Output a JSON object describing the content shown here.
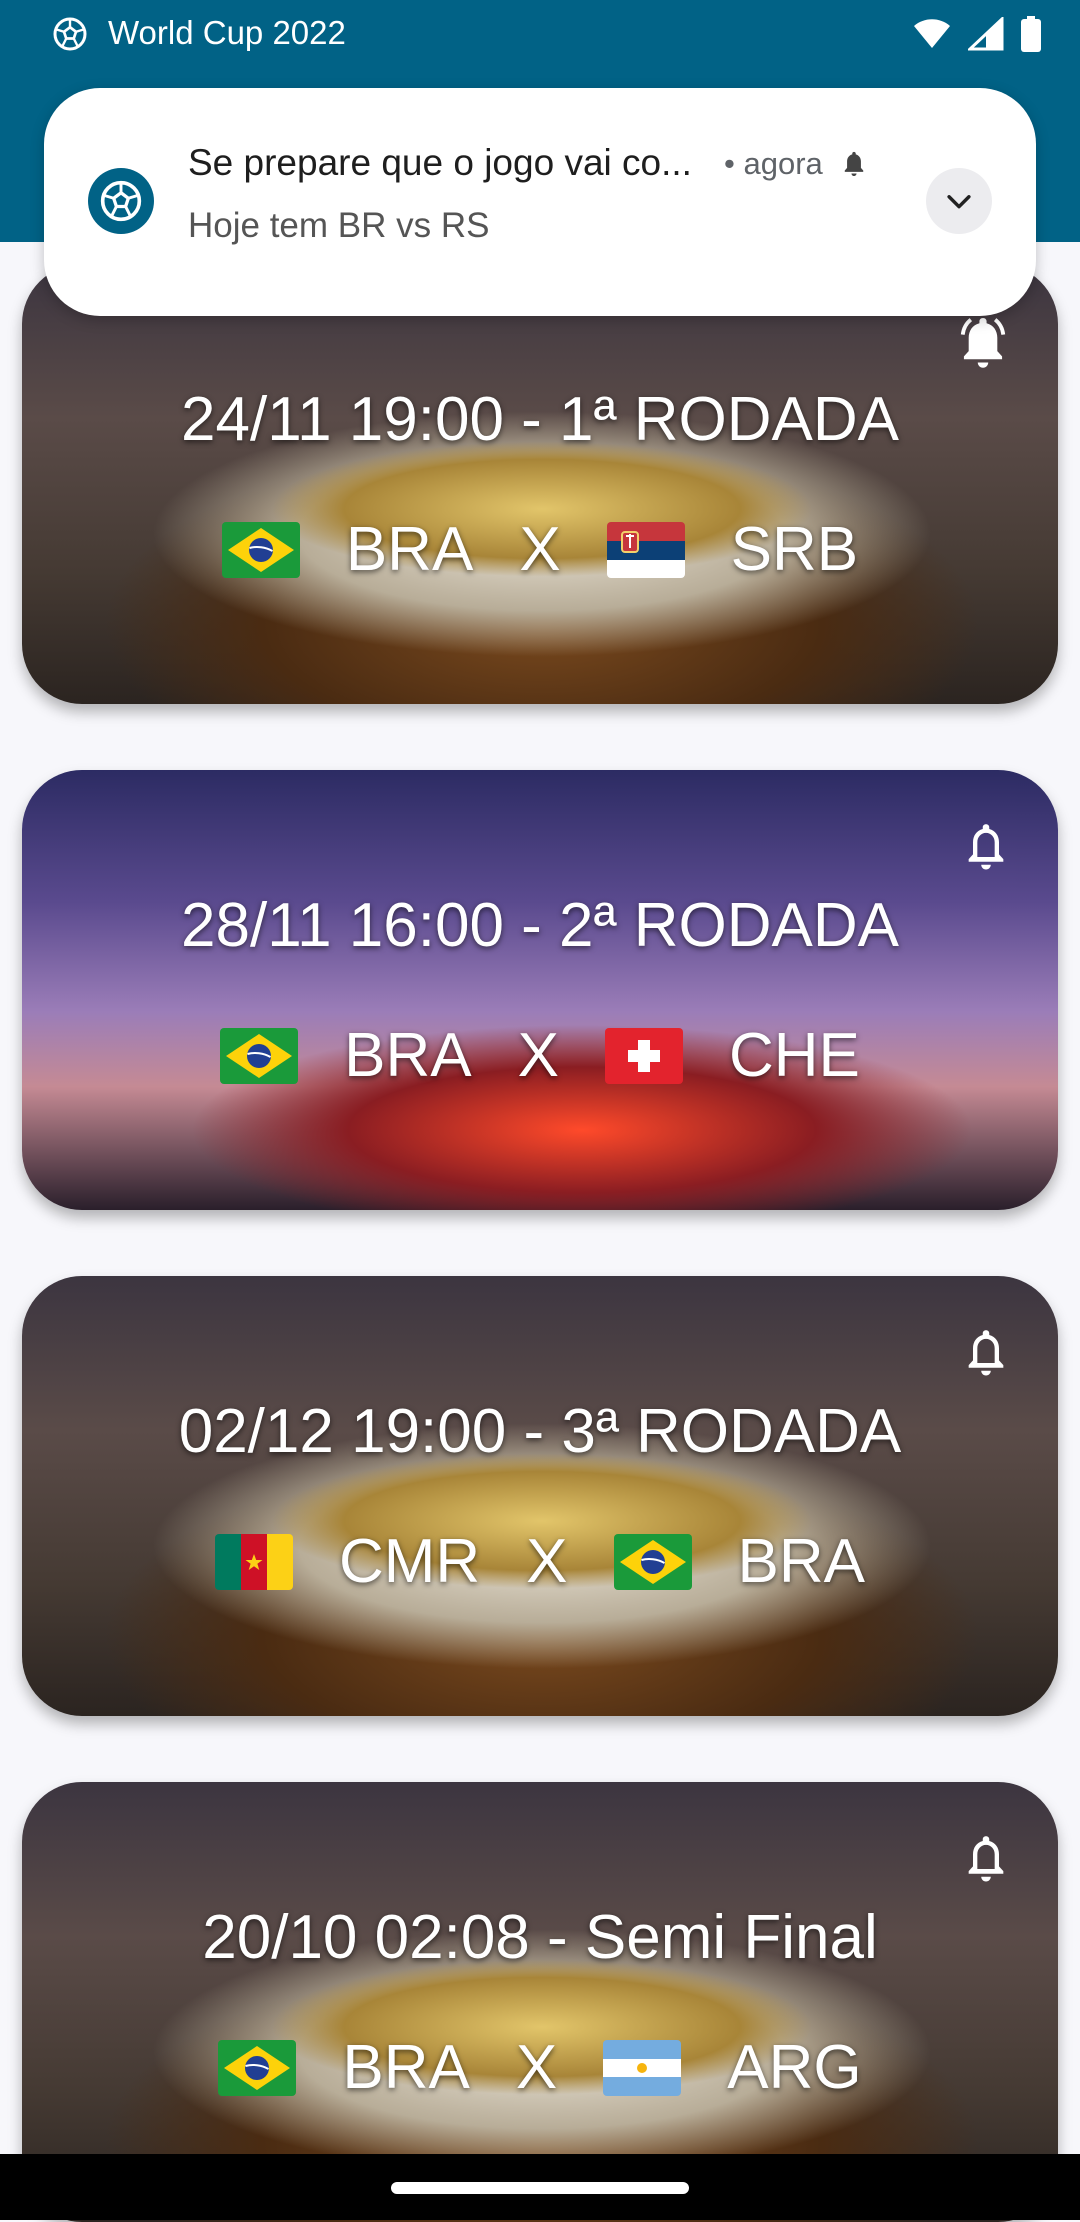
{
  "status_bar": {
    "app_title": "World Cup 2022",
    "icons": [
      "wifi-icon",
      "signal-icon",
      "battery-icon"
    ]
  },
  "notification": {
    "app_icon": "soccer-ball-icon",
    "title": "Se prepare que o jogo vai co...",
    "time": "• agora",
    "body": "Hoje tem BR vs RS",
    "bell_icon": "bell-icon",
    "expand_icon": "chevron-down-icon"
  },
  "matches": [
    {
      "title": "24/11 19:00 - 1ª RODADA",
      "home": "BRA",
      "sep": "X",
      "away": "SRB",
      "home_flag": "brazil",
      "away_flag": "serbia",
      "bell": "bell-filled"
    },
    {
      "title": "28/11 16:00 - 2ª RODADA",
      "home": "BRA",
      "sep": "X",
      "away": "CHE",
      "home_flag": "brazil",
      "away_flag": "switzerland",
      "bell": "bell-outline"
    },
    {
      "title": "02/12 19:00 - 3ª RODADA",
      "home": "CMR",
      "sep": "X",
      "away": "BRA",
      "home_flag": "cameroon",
      "away_flag": "brazil",
      "bell": "bell-outline"
    },
    {
      "title": "20/10 02:08 - Semi Final",
      "home": "BRA",
      "sep": "X",
      "away": "ARG",
      "home_flag": "brazil",
      "away_flag": "argentina",
      "bell": "bell-outline"
    }
  ],
  "colors": {
    "appbar": "#016286",
    "background": "#f7f7fb"
  }
}
